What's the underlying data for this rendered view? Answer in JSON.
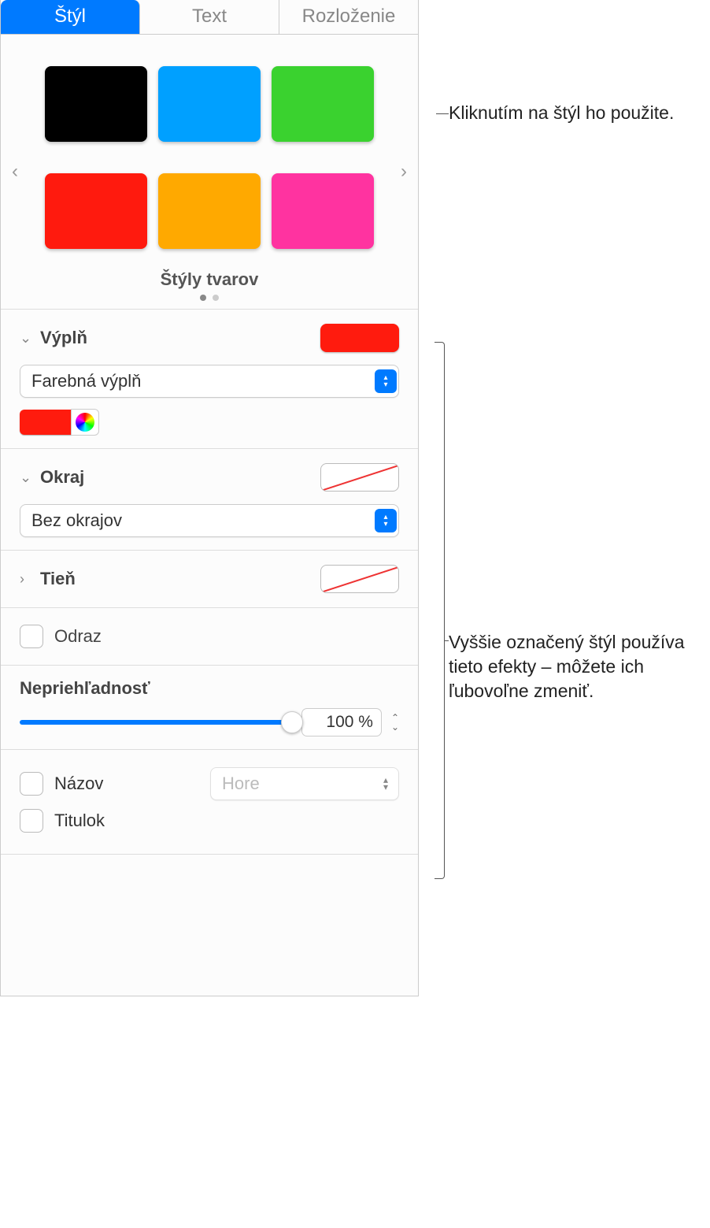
{
  "tabs": {
    "style": "Štýl",
    "text": "Text",
    "layout": "Rozloženie"
  },
  "styles_area": {
    "label": "Štýly tvarov",
    "colors": [
      "#000000",
      "#00a0ff",
      "#3ad22f",
      "#ff1a0e",
      "#ffa900",
      "#ff33a0"
    ]
  },
  "fill": {
    "header": "Výplň",
    "popup": "Farebná výplň",
    "color": "#ff1b0e"
  },
  "border": {
    "header": "Okraj",
    "popup": "Bez okrajov"
  },
  "shadow": {
    "header": "Tieň"
  },
  "reflect": {
    "label": "Odraz"
  },
  "opacity": {
    "label": "Nepriehľadnosť",
    "value": "100 %"
  },
  "title_caption": {
    "name_label": "Názov",
    "name_popup": "Hore",
    "caption_label": "Titulok"
  },
  "callouts": {
    "a": "Kliknutím na štýl ho použite.",
    "b": "Vyššie označený štýl používa tieto efekty – môžete ich ľubovoľne zmeniť."
  }
}
